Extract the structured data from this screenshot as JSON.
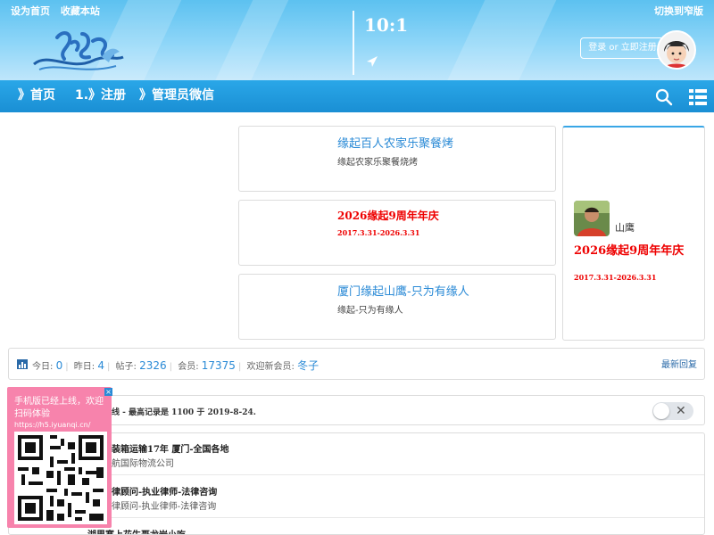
{
  "header": {
    "top_links": [
      "设为首页",
      "收藏本站"
    ],
    "narrow_link": "切换到窄版",
    "clock": "10:1",
    "login_button": "登录 or 立即注册"
  },
  "nav": {
    "items": [
      "》首页",
      "1.》注册",
      "》管理员微信"
    ]
  },
  "cards": [
    {
      "title": "缘起百人农家乐聚餐烤",
      "subtitle": "缘起农家乐聚餐烧烤"
    },
    {
      "title": "2026缘起9周年年庆",
      "subtitle": "2017.3.31-2026.3.31"
    },
    {
      "title": "厦门缘起山鹰-只为有缘人",
      "subtitle": "缘起-只为有缘人"
    }
  ],
  "side_card": {
    "name": "山鹰",
    "title": "2026缘起9周年年庆",
    "dates": "2017.3.31-2026.3.31"
  },
  "stats": {
    "today_label": "今日: ",
    "today": "0",
    "yesterday_label": "昨日: ",
    "yesterday": "4",
    "posts_label": "帖子: ",
    "posts": "2326",
    "members_label": "会员: ",
    "members": "17375",
    "welcome_label": "欢迎新会员: ",
    "new_member": "冬子",
    "latest_reply": "最新回复"
  },
  "online": {
    "text": "线 - 最高记录是 1100 于 2019-8-24."
  },
  "list": [
    {
      "title": "装箱运输17年 厦门-全国各地",
      "subtitle": "航国际物流公司"
    },
    {
      "title": "律顾问-执业律师-法律咨询",
      "subtitle": "律顾问-执业律师-法律咨询"
    },
    {
      "title": "湖里塞上花生哥龙岩小吃",
      "subtitle": ""
    }
  ],
  "qr_popup": {
    "close": "×",
    "message": "手机版已经上线，欢迎扫码体验",
    "url": "https://h5.iyuanqi.cn/"
  },
  "colors": {
    "header_sky": "#5cc1f0",
    "navbar": "#1a8fd4",
    "link_blue": "#2a8ad6",
    "event_red": "#ee0000",
    "qr_pink": "#f783ac"
  }
}
